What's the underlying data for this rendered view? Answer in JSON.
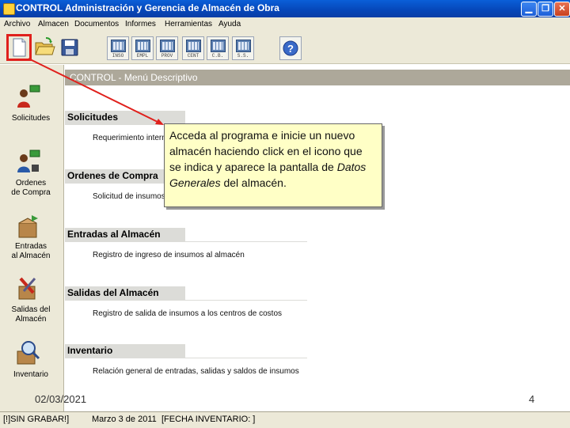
{
  "window": {
    "app_name": "CONTROL",
    "doc_title": "Administración y Gerencia de Almacén de Obra",
    "min_symbol": "▁",
    "max_symbol": "❐",
    "close_symbol": "✕"
  },
  "menu": [
    "Archivo",
    "Almacen",
    "Documentos",
    "Informes",
    "Herramientas",
    "Ayuda"
  ],
  "toolbar": {
    "small_buttons": [
      "INSO",
      "EMPL",
      "PROV",
      "CENT",
      "C.B.",
      "S.S."
    ]
  },
  "sidebar": {
    "items": [
      {
        "label_line1": "Solicitudes",
        "label_line2": "",
        "icon": "person-request-icon"
      },
      {
        "label_line1": "Ordenes",
        "label_line2": "de Compra",
        "icon": "person-order-icon"
      },
      {
        "label_line1": "Entradas",
        "label_line2": "al Almacén",
        "icon": "box-in-icon"
      },
      {
        "label_line1": "Salidas del",
        "label_line2": "Almacén",
        "icon": "tools-out-icon"
      },
      {
        "label_line1": "Inventario",
        "label_line2": "",
        "icon": "magnifier-box-icon"
      }
    ]
  },
  "main": {
    "header": "CONTROL - Menú Descriptivo",
    "sections": [
      {
        "title": "Solicitudes",
        "desc": "Requerimiento interno"
      },
      {
        "title": "Ordenes de Compra",
        "desc": "Solicitud de insumos"
      },
      {
        "title": "Entradas al Almacén",
        "desc": "Registro de ingreso de insumos al almacén"
      },
      {
        "title": "Salidas del Almacén",
        "desc": "Registro de salida de insumos a los centros de costos"
      },
      {
        "title": "Inventario",
        "desc": "Relación general de entradas, salidas y saldos de insumos"
      }
    ]
  },
  "callout": {
    "text_part1": "Acceda al programa e inicie un nuevo almacén haciendo click en el icono que se indica y aparece la pantalla de ",
    "text_italic": "Datos Generales",
    "text_part2": " del almacén."
  },
  "statusbar": {
    "left": "[!]SIN GRABAR!]",
    "date": "Marzo 3 de 2011",
    "info": "[FECHA INVENTARIO: ]"
  },
  "slide": {
    "date": "02/03/2021",
    "number": "4"
  },
  "colors": {
    "highlight_red": "#e0201c",
    "callout_bg": "#ffffc6"
  }
}
